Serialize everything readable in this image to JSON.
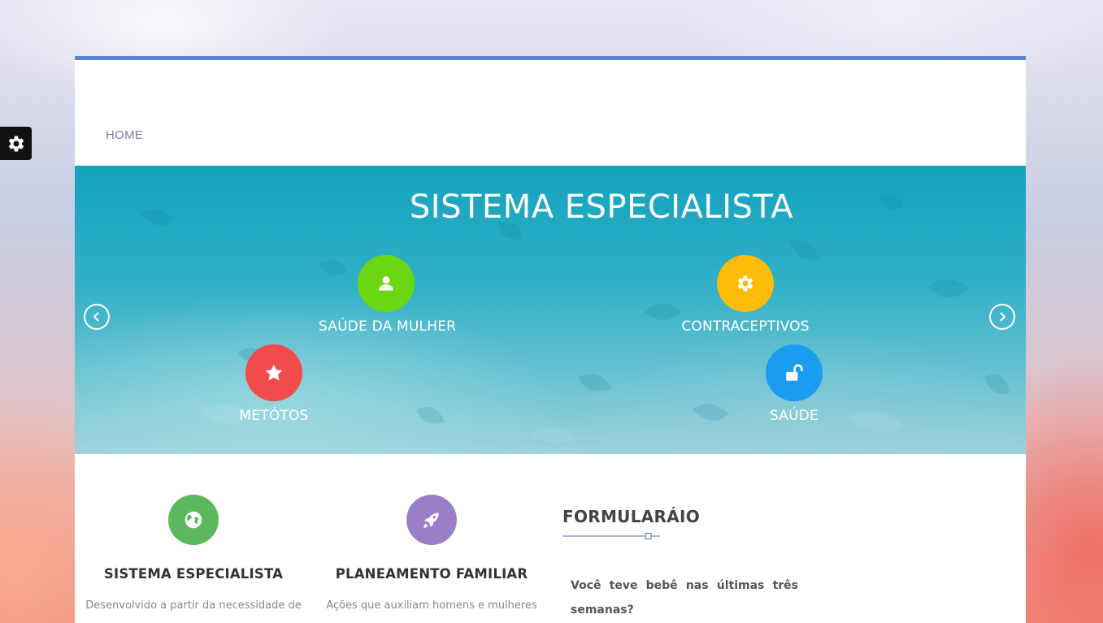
{
  "settings_panel": {
    "icon": "gear-icon"
  },
  "nav": {
    "items": [
      {
        "label": "HOME"
      }
    ]
  },
  "hero": {
    "title": "SISTEMA ESPECIALISTA",
    "features": [
      {
        "label": "SAÚDE DA MULHER",
        "icon": "user-icon",
        "color": "#6bd612"
      },
      {
        "label": "CONTRACEPTIVOS",
        "icon": "gear-icon",
        "color": "#fdbb0a"
      },
      {
        "label": "METÓTOS",
        "icon": "star-icon",
        "color": "#f24b4b"
      },
      {
        "label": "SAÚDE",
        "icon": "unlock-icon",
        "color": "#1a9df0"
      }
    ],
    "prev_icon": "chevron-left-icon",
    "next_icon": "chevron-right-icon"
  },
  "columns": [
    {
      "title": "SISTEMA ESPECIALISTA",
      "text": "Desenvolvido a partir da necessidade de se",
      "icon": "globe-icon",
      "color": "#5cb85c"
    },
    {
      "title": "PLANEAMENTO FAMILIAR",
      "text": "Ações que auxiliam homens e mulheres a",
      "icon": "rocket-icon",
      "color": "#9b7ec8"
    }
  ],
  "form": {
    "title": "FORMULARÁIO",
    "question": "Você teve bebê nas últimas três semanas?"
  },
  "colors": {
    "accent": "#5b86d6",
    "nav_text": "#7b7fa8"
  }
}
